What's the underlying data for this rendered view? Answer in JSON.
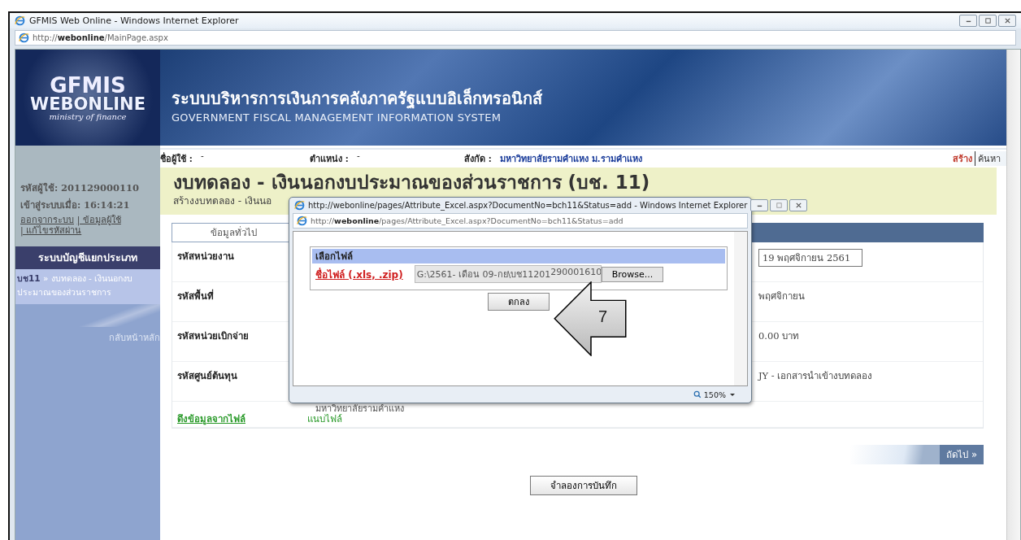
{
  "browser": {
    "title": "GFMIS Web Online - Windows Internet Explorer",
    "address": "http://**webonline**/MainPage.aspx"
  },
  "banner": {
    "logo_lines": [
      "GFMIS",
      "WEBONLINE",
      "ministry of finance"
    ],
    "title_th": "ระบบบริหารการเงินการคลังภาครัฐแบบอิเล็กทรอนิกส์",
    "title_en": "GOVERNMENT FISCAL MANAGEMENT INFORMATION SYSTEM"
  },
  "sidebar": {
    "user_label": "รหัสผู้ใช้:",
    "user_id": "201129000110",
    "login_label": "เข้าสู่ระบบเมื่อ:",
    "login_time": "16:14:21",
    "links": [
      "ออกจากระบบ",
      "| ข้อมูลผู้ใช้",
      "| แก้ไขรหัสผ่าน"
    ],
    "menu_title": "ระบบบัญชีแยกประเภท",
    "menu_items": [
      {
        "label": "**บช11** » งบทดลอง - เงินนอกงบประมาณของส่วนราชการ",
        "selected": true
      }
    ],
    "back": "กลับหน้าหลัก"
  },
  "header": {
    "fields": [
      {
        "label": "ชื่อผู้ใช้ :",
        "value": "-"
      },
      {
        "label": "ตำแหน่ง :",
        "value": "-"
      },
      {
        "label": "สังกัด :",
        "value": "มหาวิทยาลัยรามคำแหง ม.รามคำแหง"
      }
    ],
    "actions": [
      {
        "label": "สร้าง",
        "selected": true
      },
      {
        "label": "ค้นหา",
        "selected": false
      }
    ]
  },
  "page": {
    "title": "งบทดลอง - เงินนอกงบประมาณของส่วนราชการ (บช. 11)",
    "subtitle": "สร้างงบทดลอง - เงินนอ"
  },
  "tabs": [
    {
      "label": "ข้อมูลทั่วไป",
      "selected": true
    }
  ],
  "form_rows": [
    {
      "kind": "field",
      "label": "รหัสหน่วยงาน",
      "right": {
        "kind": "input",
        "value": "19 พฤศจิกายน 2561"
      }
    },
    {
      "kind": "field",
      "label": "รหัสพื้นที่",
      "right": {
        "kind": "text",
        "value": "พฤศจิกายน"
      }
    },
    {
      "kind": "field",
      "label": "รหัสหน่วยเบิกจ่าย",
      "right": {
        "kind": "text",
        "value": "0.00 บาท"
      }
    },
    {
      "kind": "field",
      "label": "รหัสศูนย์ต้นทุน",
      "right": {
        "kind": "text",
        "value": "JY - เอกสารนำเข้างบทดลอง"
      },
      "sub_value": "มหาวิทยาลัยรามคำแหง"
    },
    {
      "kind": "link",
      "label": "ดึงข้อมูลจากไฟล์",
      "value": "แนบไฟล์"
    }
  ],
  "next_button": "ถัดไป »",
  "save_button": "จำลองการบันทึก",
  "popup": {
    "title": "http://webonline/pages/Attribute_Excel.aspx?DocumentNo=bch11&Status=add - Windows Internet Explorer",
    "address": "http://**webonline**/pages/Attribute_Excel.aspx?DocumentNo=bch11&Status=add",
    "panel_title": "เลือกไฟล์",
    "file_label": "ชื่อไฟล์ (.xls, .zip)",
    "file_path_parts": [
      "G:\\2561- เดือน 09-กย\\บช11201",
      "290001610"
    ],
    "browse": "Browse...",
    "ok": "ตกลง",
    "zoom": "150%"
  },
  "callout": {
    "label": "7"
  }
}
